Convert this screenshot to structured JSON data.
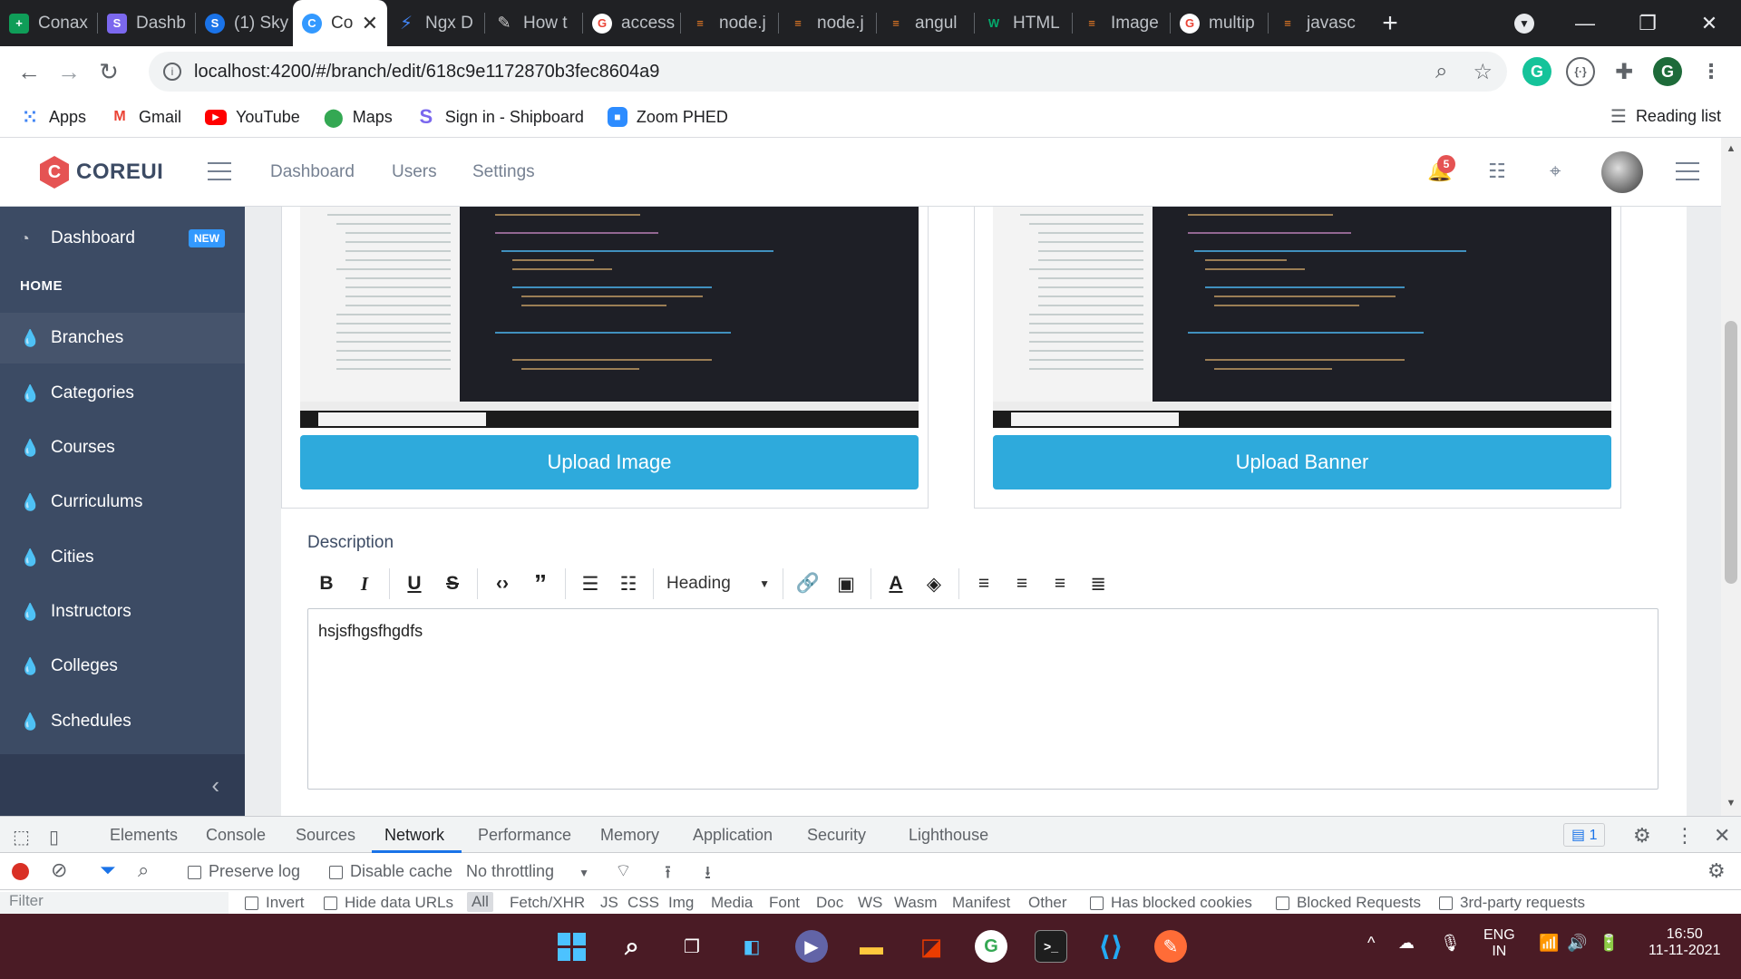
{
  "browser": {
    "tabs": [
      {
        "label": "Conax",
        "icon": "plus-icon",
        "color": "#0f9d58"
      },
      {
        "label": "Dashb",
        "icon": "s-icon",
        "color": "#7b68ee"
      },
      {
        "label": "(1) Sky",
        "icon": "skype-icon",
        "color": "#1a73e8"
      },
      {
        "label": "Co",
        "icon": "coreui-icon",
        "color": "#39f",
        "active": true
      },
      {
        "label": "Ngx D",
        "icon": "bolt-icon",
        "color": "#4285f4"
      },
      {
        "label": "How t",
        "icon": "pen-icon",
        "color": "#cccccc"
      },
      {
        "label": "access",
        "icon": "google-icon",
        "color": "#ea4335"
      },
      {
        "label": "node.j",
        "icon": "stackoverflow-icon",
        "color": "#f48024"
      },
      {
        "label": "node.j",
        "icon": "stackoverflow-icon",
        "color": "#f48024"
      },
      {
        "label": "angul",
        "icon": "stackoverflow-icon",
        "color": "#f48024"
      },
      {
        "label": "HTML",
        "icon": "w3-icon",
        "color": "#04aa6d"
      },
      {
        "label": "Image",
        "icon": "stackoverflow-icon",
        "color": "#f48024"
      },
      {
        "label": "multip",
        "icon": "google-icon",
        "color": "#ea4335"
      },
      {
        "label": "javasc",
        "icon": "stackoverflow-icon",
        "color": "#f48024"
      }
    ],
    "url": "localhost:4200/#/branch/edit/618c9e1172870b3fec8604a9",
    "profile_initial": "G",
    "bookmarks": [
      {
        "label": "Apps",
        "icon": "apps-icon"
      },
      {
        "label": "Gmail",
        "icon": "gmail-icon"
      },
      {
        "label": "YouTube",
        "icon": "youtube-icon"
      },
      {
        "label": "Maps",
        "icon": "maps-icon"
      },
      {
        "label": "Sign in - Shipboard",
        "icon": "s-icon"
      },
      {
        "label": "Zoom PHED",
        "icon": "zoom-icon"
      }
    ],
    "reading_list": "Reading list"
  },
  "app": {
    "logo": "COREUI",
    "nav": [
      "Dashboard",
      "Users",
      "Settings"
    ],
    "notification_count": "5"
  },
  "sidebar": {
    "dashboard": "Dashboard",
    "new_badge": "NEW",
    "section_title": "HOME",
    "items": [
      "Branches",
      "Categories",
      "Courses",
      "Curriculums",
      "Cities",
      "Instructors",
      "Colleges",
      "Schedules"
    ]
  },
  "main": {
    "upload_image": "Upload Image",
    "upload_banner": "Upload Banner",
    "description_label": "Description",
    "heading_select": "Heading",
    "editor_text": "hsjsfhgsfhgdfs"
  },
  "devtools": {
    "tabs": [
      "Elements",
      "Console",
      "Sources",
      "Network",
      "Performance",
      "Memory",
      "Application",
      "Security",
      "Lighthouse"
    ],
    "active_tab": "Network",
    "issues_count": "1",
    "preserve_log": "Preserve log",
    "disable_cache": "Disable cache",
    "throttling": "No throttling",
    "filter_placeholder": "Filter",
    "invert": "Invert",
    "hide_data_urls": "Hide data URLs",
    "types": [
      "All",
      "Fetch/XHR",
      "JS",
      "CSS",
      "Img",
      "Media",
      "Font",
      "Doc",
      "WS",
      "Wasm",
      "Manifest",
      "Other"
    ],
    "has_blocked_cookies": "Has blocked cookies",
    "blocked_requests": "Blocked Requests",
    "third_party": "3rd-party requests"
  },
  "taskbar": {
    "lang_top": "ENG",
    "lang_bottom": "IN",
    "time": "16:50",
    "date": "11-11-2021"
  }
}
